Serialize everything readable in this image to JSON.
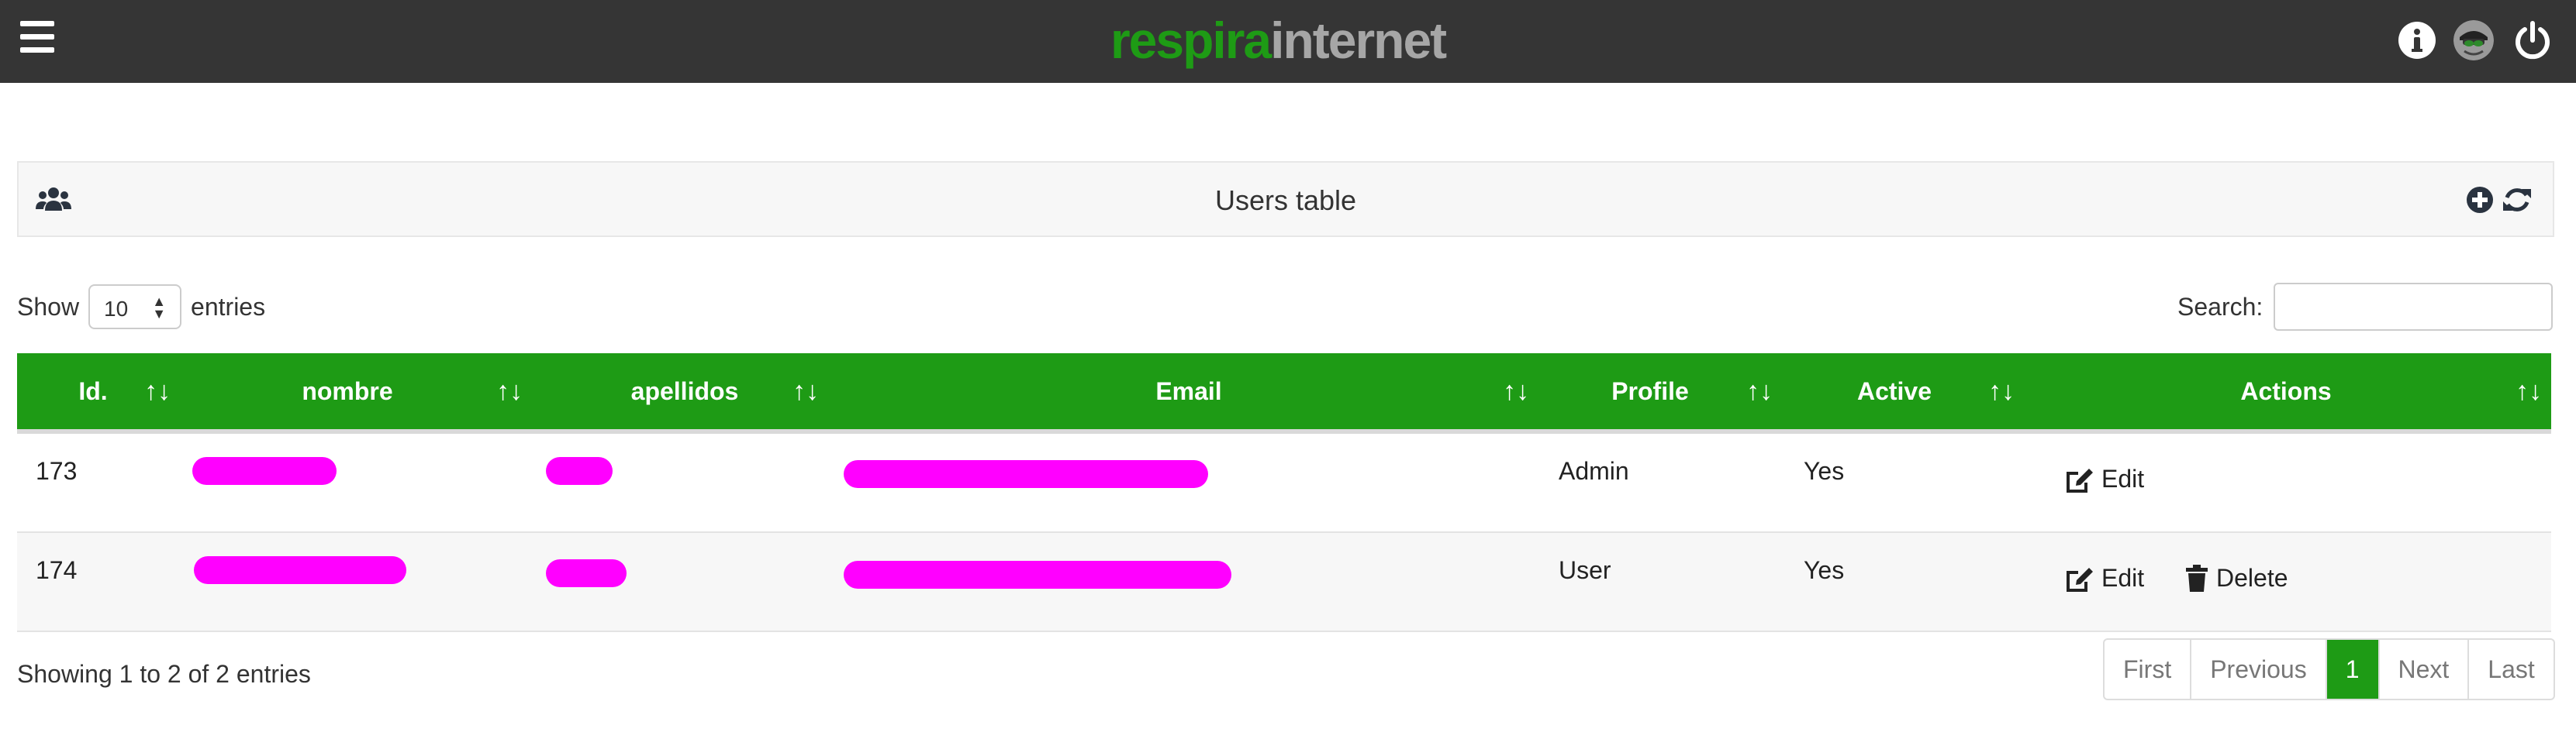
{
  "header": {
    "logo_part1": "respira",
    "logo_part2": "internet",
    "menu_icon": "hamburger-menu-icon",
    "info_icon": "info-circle-icon",
    "avatar_icon": "user-avatar",
    "power_icon": "power-icon"
  },
  "panel": {
    "title": "Users table",
    "left_icon": "users-icon",
    "add_icon": "plus-circle-icon",
    "refresh_icon": "refresh-icon"
  },
  "controls": {
    "show_label": "Show",
    "entries_value": "10",
    "entries_label": "entries",
    "search_label": "Search:",
    "search_value": ""
  },
  "table": {
    "columns": [
      "Id.",
      "nombre",
      "apellidos",
      "Email",
      "Profile",
      "Active",
      "Actions"
    ],
    "rows": [
      {
        "id": "173",
        "profile": "Admin",
        "active": "Yes",
        "edit": "Edit"
      },
      {
        "id": "174",
        "profile": "User",
        "active": "Yes",
        "edit": "Edit",
        "delete": "Delete"
      }
    ]
  },
  "footer": {
    "info": "Showing 1 to 2 of 2 entries",
    "pager": [
      "First",
      "Previous",
      "1",
      "Next",
      "Last"
    ],
    "active_page": "1"
  },
  "colors": {
    "brand_green": "#1e9b15",
    "topbar": "#353535",
    "redaction": "#ff00ff"
  }
}
